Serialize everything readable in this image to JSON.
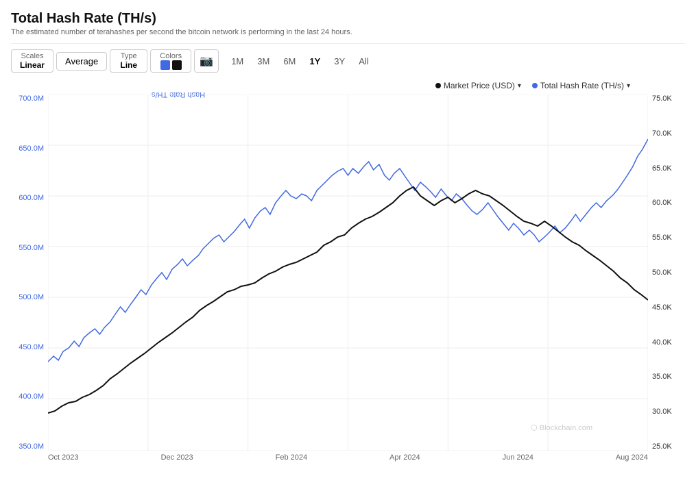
{
  "page": {
    "title": "Total Hash Rate (TH/s)",
    "subtitle": "The estimated number of terahashes per second the bitcoin network is performing in the last 24 hours."
  },
  "toolbar": {
    "scales_label": "Scales",
    "scales_value": "Linear",
    "average_label": "Average",
    "type_label": "Type",
    "type_value": "Line",
    "colors_label": "Colors",
    "camera_label": "📷",
    "time_buttons": [
      "1M",
      "3M",
      "6M",
      "1Y",
      "3Y",
      "All"
    ],
    "active_time": "1Y"
  },
  "legend": {
    "market_price_label": "Market Price (USD)",
    "hash_rate_label": "Total Hash Rate (TH/s)"
  },
  "yaxis_left": {
    "title": "Hash Rate TH/s",
    "values": [
      "700.0M",
      "650.0M",
      "600.0M",
      "550.0M",
      "500.0M",
      "450.0M",
      "400.0M",
      "350.0M"
    ]
  },
  "yaxis_right": {
    "values": [
      "75.0K",
      "70.0K",
      "65.0K",
      "60.0K",
      "55.0K",
      "50.0K",
      "45.0K",
      "40.0K",
      "35.0K",
      "30.0K",
      "25.0K"
    ]
  },
  "xaxis": {
    "labels": [
      "Oct 2023",
      "Dec 2023",
      "Feb 2024",
      "Apr 2024",
      "Jun 2024",
      "Aug 2024"
    ]
  },
  "colors": {
    "hash_rate": "#4169e1",
    "market_price": "#111111",
    "grid": "#eeeeee",
    "swatch_blue": "#4169e1",
    "swatch_black": "#222222"
  },
  "watermark": {
    "text": "Blockchain.com"
  }
}
